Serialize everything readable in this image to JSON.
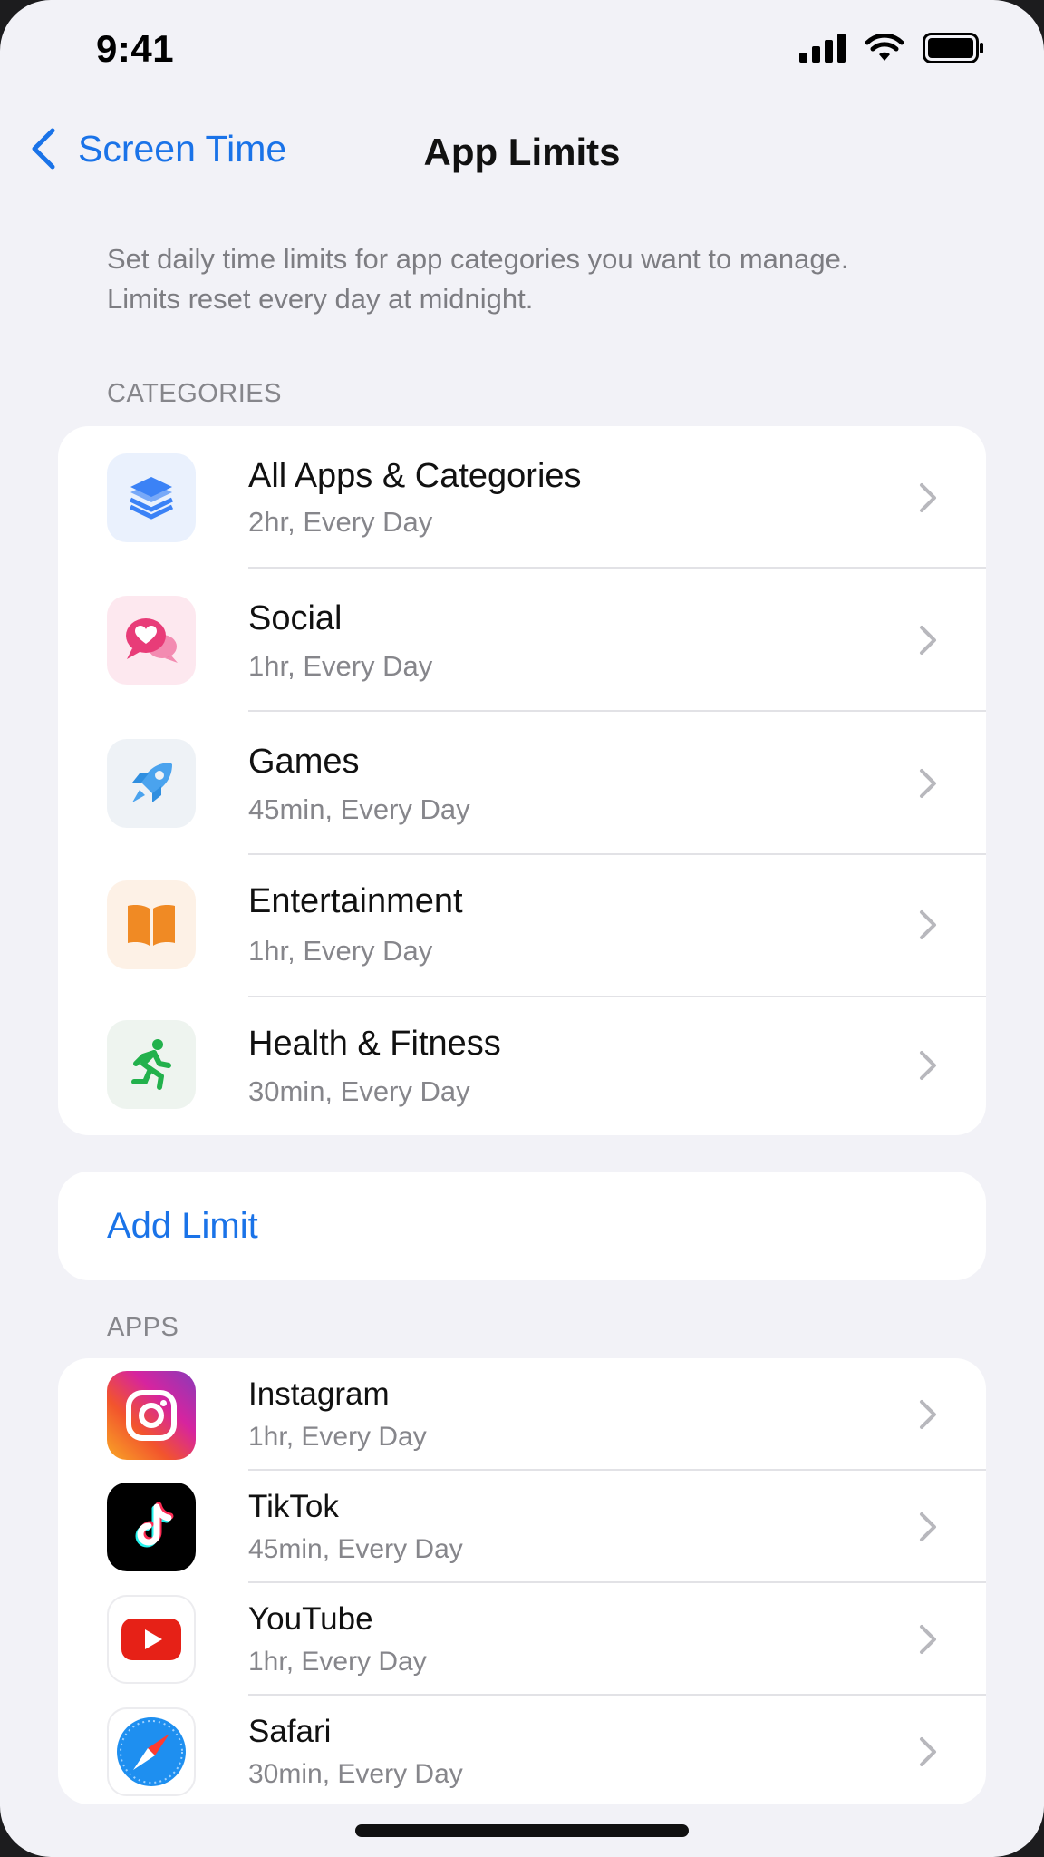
{
  "status_bar": {
    "time": "9:41"
  },
  "nav": {
    "back_label": "Screen Time",
    "title": "App Limits"
  },
  "description": "Set daily time limits for app categories you want to manage. Limits reset every day at midnight.",
  "categories_section": {
    "header": "CATEGORIES",
    "items": [
      {
        "title": "All Apps & Categories",
        "subtitle": "2hr, Every Day",
        "icon": "stack-icon"
      },
      {
        "title": "Social",
        "subtitle": "1hr, Every Day",
        "icon": "chat-heart-icon"
      },
      {
        "title": "Games",
        "subtitle": "45min, Every Day",
        "icon": "rocket-icon"
      },
      {
        "title": "Entertainment",
        "subtitle": "1hr, Every Day",
        "icon": "book-icon"
      },
      {
        "title": "Health & Fitness",
        "subtitle": "30min, Every Day",
        "icon": "running-figure-icon"
      }
    ]
  },
  "add_limit_label": "Add Limit",
  "apps_section": {
    "header": "APPS",
    "items": [
      {
        "title": "Instagram",
        "subtitle": "1hr, Every Day",
        "icon": "instagram-icon"
      },
      {
        "title": "TikTok",
        "subtitle": "45min, Every Day",
        "icon": "tiktok-icon"
      },
      {
        "title": "YouTube",
        "subtitle": "1hr, Every Day",
        "icon": "youtube-icon"
      },
      {
        "title": "Safari",
        "subtitle": "30min, Every Day",
        "icon": "safari-icon"
      }
    ]
  },
  "colors": {
    "accent": "#1a73e8",
    "background": "#f2f2f7",
    "secondary_text": "#86868b"
  }
}
